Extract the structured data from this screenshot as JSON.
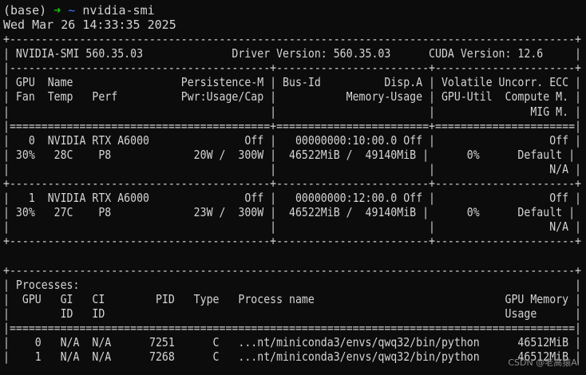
{
  "prompt": {
    "env": "(base)",
    "arrow": "➜",
    "cwd": "~",
    "command": "nvidia-smi"
  },
  "datetime": "Wed Mar 26 14:33:35 2025",
  "table": [
    "+-----------------------------------------------------------------------------------------+",
    "| NVIDIA-SMI 560.35.03              Driver Version: 560.35.03      CUDA Version: 12.6     |",
    "|-----------------------------------------+------------------------+----------------------+",
    "| GPU  Name                 Persistence-M | Bus-Id          Disp.A | Volatile Uncorr. ECC |",
    "| Fan  Temp   Perf          Pwr:Usage/Cap |           Memory-Usage | GPU-Util  Compute M. |",
    "|                                         |                        |               MIG M. |",
    "|=========================================+========================+======================|",
    "|   0  NVIDIA RTX A6000               Off |   00000000:10:00.0 Off |                  Off |",
    "| 30%   28C    P8             20W /  300W |  46522MiB /  49140MiB |      0%      Default |",
    "|                                         |                        |                  N/A |",
    "+-----------------------------------------+------------------------+----------------------+",
    "|   1  NVIDIA RTX A6000               Off |   00000000:12:00.0 Off |                  Off |",
    "| 30%   27C    P8             23W /  300W |  46522MiB /  49140MiB |      0%      Default |",
    "|                                         |                        |                  N/A |",
    "+-----------------------------------------+------------------------+----------------------+",
    "",
    "+-----------------------------------------------------------------------------------------+",
    "| Processes:                                                                              |",
    "|  GPU   GI   CI        PID   Type   Process name                              GPU Memory |",
    "|        ID   ID                                                               Usage      |",
    "|=========================================================================================|",
    "|    0   N/A  N/A      7251      C   ...nt/miniconda3/envs/qwq32/bin/python      46512MiB |",
    "|    1   N/A  N/A      7268      C   ...nt/miniconda3/envs/qwq32/bin/python      46512MiB |"
  ],
  "watermark": "CSDN @老高猿AI"
}
